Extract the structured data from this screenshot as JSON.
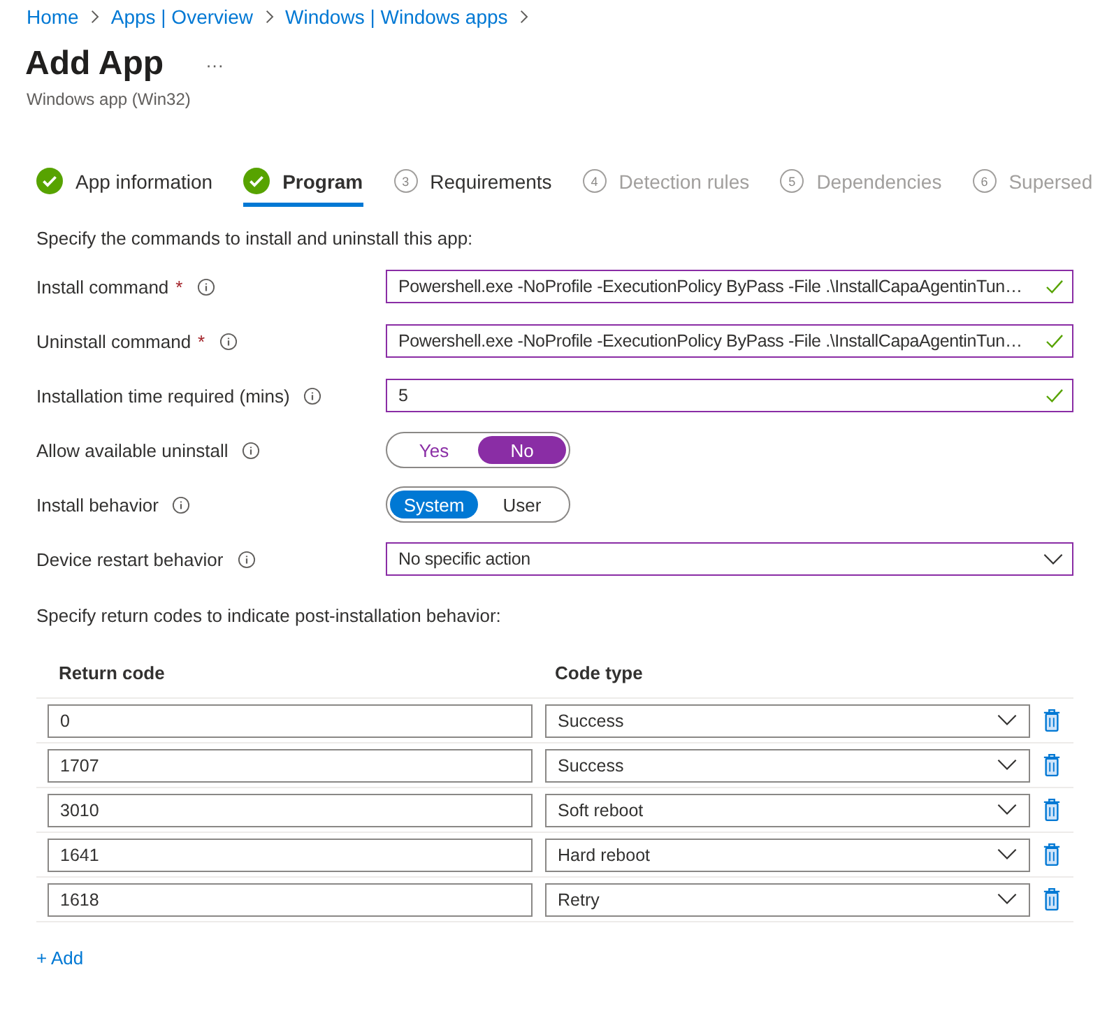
{
  "breadcrumb": [
    "Home",
    "Apps | Overview",
    "Windows | Windows apps"
  ],
  "title": "Add App",
  "more_button": "···",
  "subtitle": "Windows app (Win32)",
  "steps": [
    {
      "label": "App information",
      "done": true,
      "selected": false,
      "disabled": false
    },
    {
      "label": "Program",
      "done": true,
      "selected": true,
      "disabled": false
    },
    {
      "number": "3",
      "label": "Requirements",
      "done": false,
      "selected": false,
      "disabled": false
    },
    {
      "number": "4",
      "label": "Detection rules",
      "done": false,
      "selected": false,
      "disabled": true
    },
    {
      "number": "5",
      "label": "Dependencies",
      "done": false,
      "selected": false,
      "disabled": true
    },
    {
      "number": "6",
      "label": "Supersed",
      "done": false,
      "selected": false,
      "disabled": true
    }
  ],
  "intro": "Specify the commands to install and uninstall this app:",
  "fields": [
    {
      "kind": "text",
      "label": "Install command",
      "required_mark": "*",
      "value": "Powershell.exe -NoProfile -ExecutionPolicy ByPass -File .\\InstallCapaAgentinTun…",
      "valid": true
    },
    {
      "kind": "text",
      "label": "Uninstall command",
      "required_mark": "*",
      "value": "Powershell.exe -NoProfile -ExecutionPolicy ByPass -File .\\InstallCapaAgentinTun…",
      "valid": true
    },
    {
      "kind": "text",
      "label": "Installation time required (mins)",
      "value": "5",
      "valid": true
    },
    {
      "kind": "toggle",
      "label": "Allow available uninstall",
      "color": "#8a2da5",
      "options": [
        {
          "label": "Yes",
          "selected": false
        },
        {
          "label": "No",
          "selected": true
        }
      ]
    },
    {
      "kind": "toggle",
      "label": "Install behavior",
      "color": "#0078d4",
      "options": [
        {
          "label": "System",
          "selected": true
        },
        {
          "label": "User",
          "selected": false
        }
      ]
    },
    {
      "kind": "dropdown",
      "label": "Device restart behavior",
      "value": "No specific action"
    }
  ],
  "return_codes_intro": "Specify return codes to indicate post-installation behavior:",
  "table": {
    "columns": [
      "Return code",
      "Code type"
    ],
    "rows": [
      {
        "code": "0",
        "type": "Success"
      },
      {
        "code": "1707",
        "type": "Success"
      },
      {
        "code": "3010",
        "type": "Soft reboot"
      },
      {
        "code": "1641",
        "type": "Hard reboot"
      },
      {
        "code": "1618",
        "type": "Retry"
      }
    ]
  },
  "add_link": "+ Add"
}
